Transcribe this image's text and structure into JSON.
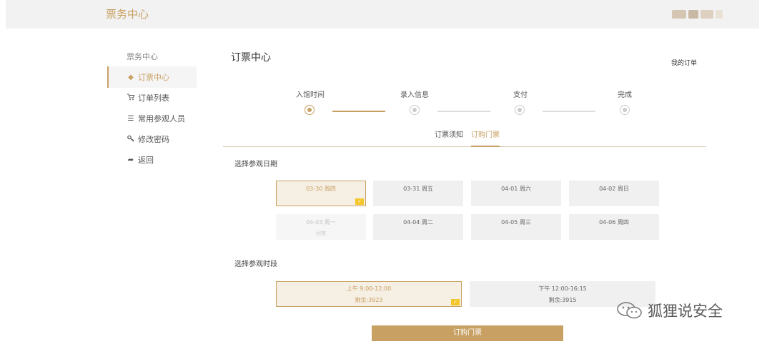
{
  "header": {
    "brand": "票务中心"
  },
  "sidebar": {
    "title": "票务中心",
    "items": [
      {
        "label": "订票中心",
        "icon": "◆"
      },
      {
        "label": "订单列表",
        "icon": "🛒"
      },
      {
        "label": "常用参观人员",
        "icon": "☰"
      },
      {
        "label": "修改密码",
        "icon": "🔍"
      },
      {
        "label": "返回",
        "icon": "➦"
      }
    ]
  },
  "main": {
    "title": "订票中心",
    "my_orders": "我的订单",
    "steps": [
      "入馆时间",
      "录入信息",
      "支付",
      "完成"
    ],
    "tabs": [
      "订票须知",
      "订购门票"
    ],
    "date_section_label": "选择参观日期",
    "dates": [
      {
        "label": "03-30 周四"
      },
      {
        "label": "03-31 周五"
      },
      {
        "label": "04-01 周六"
      },
      {
        "label": "04-02 周日"
      },
      {
        "label": "04-03 周一",
        "sub": "闭馆"
      },
      {
        "label": "04-04 周二"
      },
      {
        "label": "04-05 周三"
      },
      {
        "label": "04-06 周四"
      }
    ],
    "time_section_label": "选择参观时段",
    "slots": [
      {
        "time": "上午 9:00-12:00",
        "remaining": "剩余:3923"
      },
      {
        "time": "下午 12:00-16:15",
        "remaining": "剩余:3915"
      }
    ],
    "buy_button": "订购门票",
    "check_mark": "✓"
  },
  "watermark": {
    "text": "狐狸说安全"
  },
  "colors": {
    "accent": "#c8a063",
    "check": "#f3c629"
  }
}
